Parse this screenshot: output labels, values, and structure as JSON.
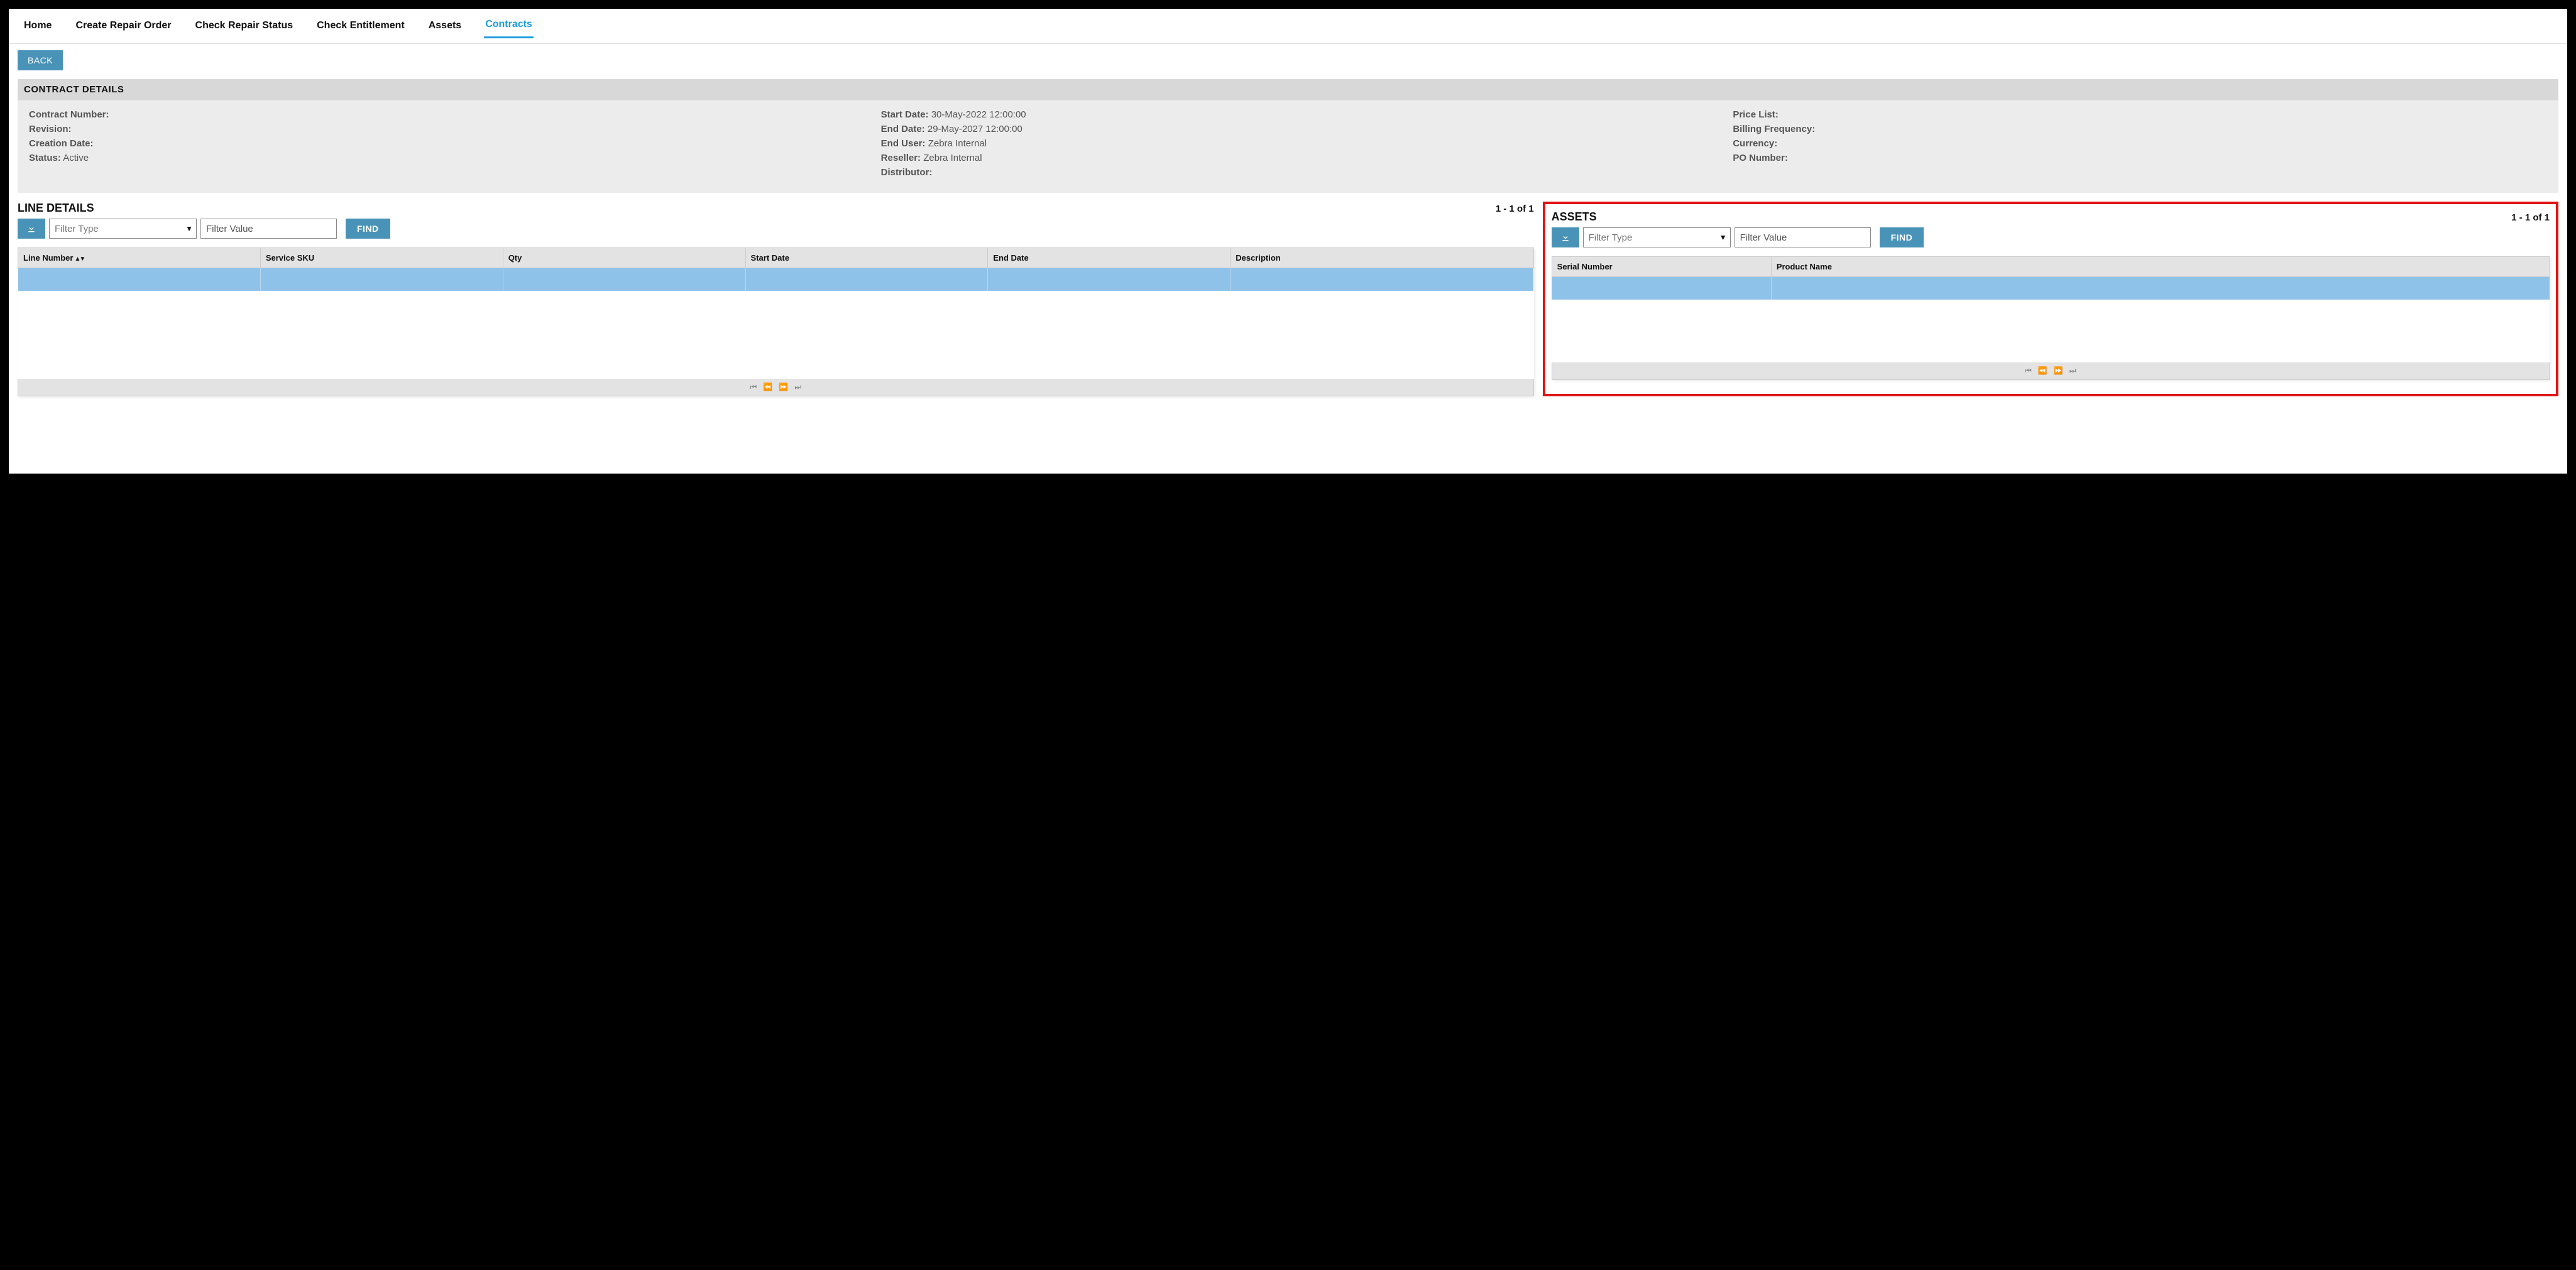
{
  "nav": {
    "home": "Home",
    "create": "Create Repair Order",
    "status": "Check Repair Status",
    "entitlement": "Check Entitlement",
    "assets": "Assets",
    "contracts": "Contracts"
  },
  "back_label": "BACK",
  "contract_section_title": "CONTRACT DETAILS",
  "details": {
    "contract_number_label": "Contract Number:",
    "contract_number_value": "",
    "revision_label": "Revision:",
    "revision_value": "",
    "creation_date_label": "Creation Date:",
    "creation_date_value": "",
    "status_label": "Status:",
    "status_value": "Active",
    "start_date_label": "Start Date:",
    "start_date_value": "30-May-2022 12:00:00",
    "end_date_label": "End Date:",
    "end_date_value": "29-May-2027 12:00:00",
    "end_user_label": "End User:",
    "end_user_value": "Zebra Internal",
    "reseller_label": "Reseller:",
    "reseller_value": "Zebra Internal",
    "distributor_label": "Distributor:",
    "distributor_value": "",
    "price_list_label": "Price List:",
    "price_list_value": "",
    "billing_freq_label": "Billing Frequency:",
    "billing_freq_value": "",
    "currency_label": "Currency:",
    "currency_value": "",
    "po_number_label": "PO Number:",
    "po_number_value": ""
  },
  "line_details": {
    "title": "LINE DETAILS",
    "count": "1 - 1 of 1",
    "filter_type_placeholder": "Filter Type",
    "filter_value_placeholder": "Filter Value",
    "find_label": "FIND",
    "cols": {
      "line_number": "Line Number",
      "service_sku": "Service SKU",
      "qty": "Qty",
      "start_date": "Start Date",
      "end_date": "End Date",
      "description": "Description"
    }
  },
  "assets_panel": {
    "title": "ASSETS",
    "count": "1 - 1 of 1",
    "filter_type_placeholder": "Filter Type",
    "filter_value_placeholder": "Filter Value",
    "find_label": "FIND",
    "cols": {
      "serial_number": "Serial Number",
      "product_name": "Product Name"
    }
  }
}
